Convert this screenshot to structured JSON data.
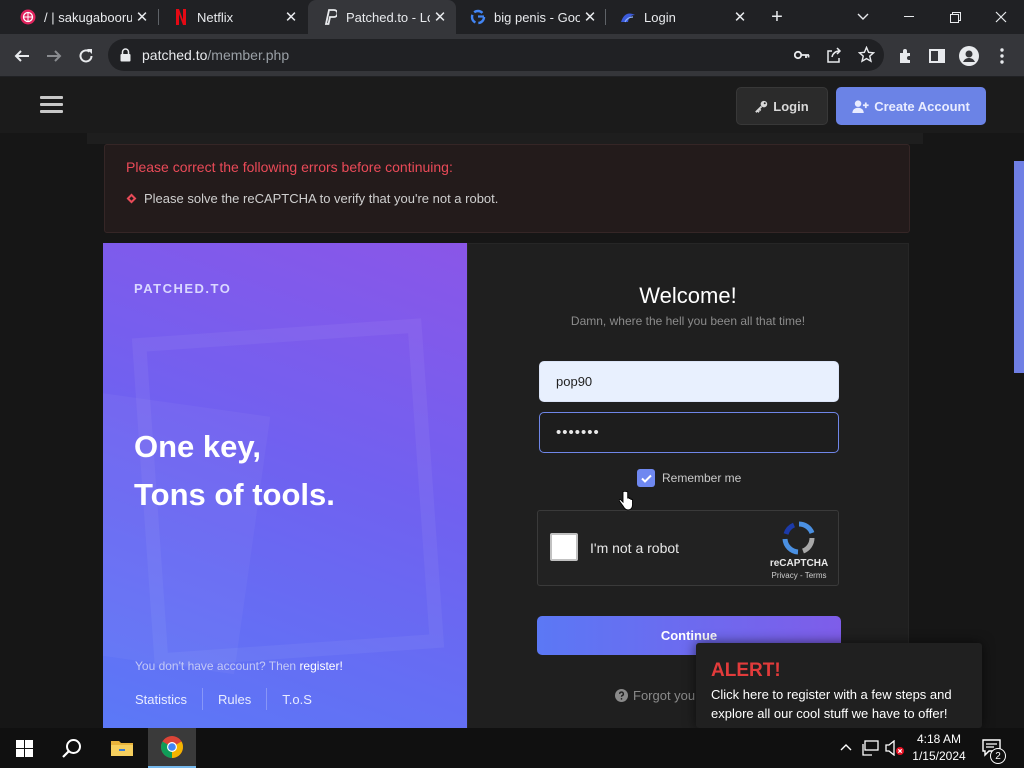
{
  "browser": {
    "tabs": [
      {
        "title": "/ | sakugabooru",
        "icon": "sakugabooru-icon"
      },
      {
        "title": "Netflix",
        "icon": "netflix-icon"
      },
      {
        "title": "Patched.to - Log",
        "icon": "patched-icon",
        "active": true
      },
      {
        "title": "big penis - Goog",
        "icon": "google-icon"
      },
      {
        "title": "Login",
        "icon": "login-site-icon"
      }
    ],
    "new_tab_glyph": "+",
    "address": {
      "host": "patched.to",
      "path": "/member.php"
    }
  },
  "site": {
    "header": {
      "login_label": "Login",
      "create_account_label": "Create Account"
    },
    "error": {
      "title": "Please correct the following errors before continuing:",
      "item": "Please solve the reCAPTCHA to verify that you're not a robot."
    },
    "left_panel": {
      "brand": "PATCHED.TO",
      "tagline_line1": "One key,",
      "tagline_line2": "Tons of tools.",
      "no_account_text": "You don't have account? Then",
      "register_link": "register!",
      "footer_links": [
        "Statistics",
        "Rules",
        "T.o.S"
      ]
    },
    "form": {
      "welcome": "Welcome!",
      "subtitle": "Damn, where the hell you been all that time!",
      "username_value": "pop90",
      "password_mask": "•••••••",
      "remember_label": "Remember me",
      "remember_checked": true,
      "captcha_label": "I'm not a robot",
      "captcha_brand": "reCAPTCHA",
      "captcha_legal": "Privacy - Terms",
      "continue_label": "Continue",
      "forgot_label": "Forgot your"
    },
    "alert": {
      "title": "ALERT!",
      "message": "Click here to register with a few steps and explore all our cool stuff we have to offer!"
    }
  },
  "taskbar": {
    "time": "4:18 AM",
    "date": "1/15/2024",
    "notification_count": "2"
  },
  "colors": {
    "accent": "#6b83e6",
    "error": "#ea4a58",
    "alert": "#e23b3b"
  }
}
